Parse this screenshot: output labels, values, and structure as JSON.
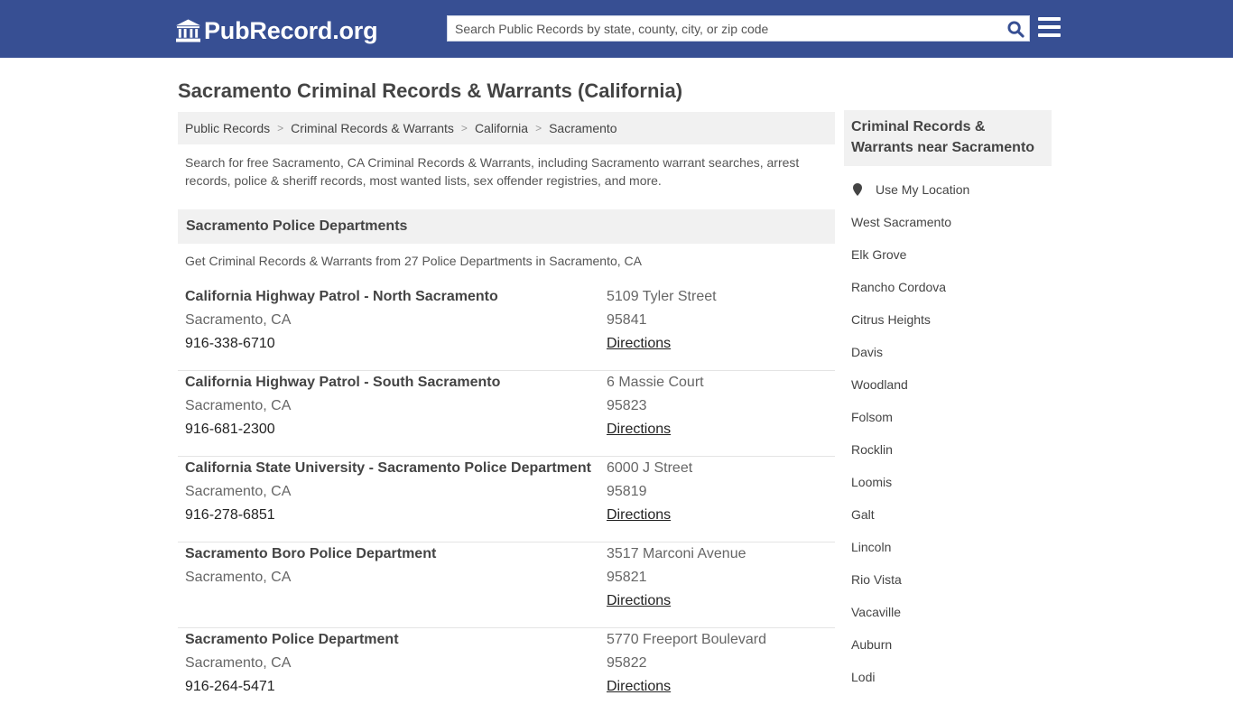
{
  "header": {
    "logo_text": "PubRecord.org",
    "search_placeholder": "Search Public Records by state, county, city, or zip code",
    "accent_color": "#374f93"
  },
  "page": {
    "title": "Sacramento Criminal Records & Warrants (California)",
    "breadcrumb": [
      "Public Records",
      "Criminal Records & Warrants",
      "California",
      "Sacramento"
    ],
    "intro": "Search for free Sacramento, CA Criminal Records & Warrants, including Sacramento warrant searches, arrest records, police & sheriff records, most wanted lists, sex offender registries, and more."
  },
  "section": {
    "title": "Sacramento Police Departments",
    "description": "Get Criminal Records & Warrants from 27 Police Departments in Sacramento, CA",
    "directions_label": "Directions",
    "listings": [
      {
        "name": "California Highway Patrol - North Sacramento",
        "city": "Sacramento, CA",
        "phone": "916-338-6710",
        "street": "5109 Tyler Street",
        "zip": "95841"
      },
      {
        "name": "California Highway Patrol - South Sacramento",
        "city": "Sacramento, CA",
        "phone": "916-681-2300",
        "street": "6 Massie Court",
        "zip": "95823"
      },
      {
        "name": "California State University - Sacramento Police Department",
        "city": "Sacramento, CA",
        "phone": "916-278-6851",
        "street": "6000 J Street",
        "zip": "95819"
      },
      {
        "name": "Sacramento Boro Police Department",
        "city": "Sacramento, CA",
        "phone": "",
        "street": "3517 Marconi Avenue",
        "zip": "95821"
      },
      {
        "name": "Sacramento Police Department",
        "city": "Sacramento, CA",
        "phone": "916-264-5471",
        "street": "5770 Freeport Boulevard",
        "zip": "95822"
      }
    ]
  },
  "sidebar": {
    "title": "Criminal Records & Warrants near Sacramento",
    "use_location": "Use My Location",
    "cities": [
      "West Sacramento",
      "Elk Grove",
      "Rancho Cordova",
      "Citrus Heights",
      "Davis",
      "Woodland",
      "Folsom",
      "Rocklin",
      "Loomis",
      "Galt",
      "Lincoln",
      "Rio Vista",
      "Vacaville",
      "Auburn",
      "Lodi"
    ]
  }
}
